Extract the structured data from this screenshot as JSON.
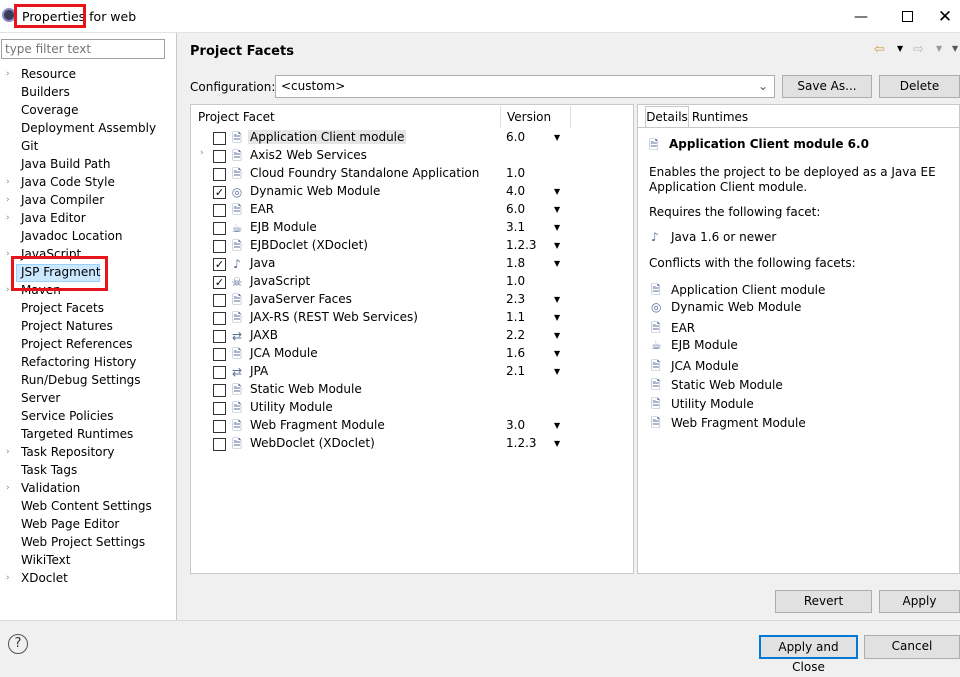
{
  "window": {
    "title": "Properties for web"
  },
  "filter": {
    "placeholder": "type filter text"
  },
  "nav": [
    {
      "label": "Resource",
      "expand": true
    },
    {
      "label": "Builders",
      "expand": false
    },
    {
      "label": "Coverage",
      "expand": false
    },
    {
      "label": "Deployment Assembly",
      "expand": false
    },
    {
      "label": "Git",
      "expand": false
    },
    {
      "label": "Java Build Path",
      "expand": false
    },
    {
      "label": "Java Code Style",
      "expand": true
    },
    {
      "label": "Java Compiler",
      "expand": true
    },
    {
      "label": "Java Editor",
      "expand": true
    },
    {
      "label": "Javadoc Location",
      "expand": false
    },
    {
      "label": "JavaScript",
      "expand": true
    },
    {
      "label": "JSP Fragment",
      "expand": false
    },
    {
      "label": "Maven",
      "expand": true
    },
    {
      "label": "Project Facets",
      "expand": false,
      "selected": true
    },
    {
      "label": "Project Natures",
      "expand": false
    },
    {
      "label": "Project References",
      "expand": false
    },
    {
      "label": "Refactoring History",
      "expand": false
    },
    {
      "label": "Run/Debug Settings",
      "expand": false
    },
    {
      "label": "Server",
      "expand": false
    },
    {
      "label": "Service Policies",
      "expand": false
    },
    {
      "label": "Targeted Runtimes",
      "expand": false
    },
    {
      "label": "Task Repository",
      "expand": true
    },
    {
      "label": "Task Tags",
      "expand": false
    },
    {
      "label": "Validation",
      "expand": true
    },
    {
      "label": "Web Content Settings",
      "expand": false
    },
    {
      "label": "Web Page Editor",
      "expand": false
    },
    {
      "label": "Web Project Settings",
      "expand": false
    },
    {
      "label": "WikiText",
      "expand": false
    },
    {
      "label": "XDoclet",
      "expand": true
    }
  ],
  "page": {
    "heading": "Project Facets"
  },
  "configuration": {
    "label": "Configuration:",
    "value": "<custom>",
    "save_as": "Save As...",
    "delete": "Delete"
  },
  "facets_table": {
    "headers": [
      "Project Facet",
      "Version"
    ],
    "rows": [
      {
        "name": "Application Client module",
        "version": "6.0",
        "checked": false,
        "dropdown": true,
        "expander": false,
        "icon": "page-icon",
        "highlight": true
      },
      {
        "name": "Axis2 Web Services",
        "version": "",
        "checked": false,
        "dropdown": false,
        "expander": true,
        "icon": "page-icon"
      },
      {
        "name": "Cloud Foundry Standalone Application",
        "version": "1.0",
        "checked": false,
        "dropdown": false,
        "expander": false,
        "icon": "page-icon"
      },
      {
        "name": "Dynamic Web Module",
        "version": "4.0",
        "checked": true,
        "dropdown": true,
        "expander": false,
        "icon": "globe-icon"
      },
      {
        "name": "EAR",
        "version": "6.0",
        "checked": false,
        "dropdown": true,
        "expander": false,
        "icon": "page-icon"
      },
      {
        "name": "EJB Module",
        "version": "3.1",
        "checked": false,
        "dropdown": true,
        "expander": false,
        "icon": "bean-icon"
      },
      {
        "name": "EJBDoclet (XDoclet)",
        "version": "1.2.3",
        "checked": false,
        "dropdown": true,
        "expander": false,
        "icon": "page-icon"
      },
      {
        "name": "Java",
        "version": "1.8",
        "checked": true,
        "dropdown": true,
        "expander": false,
        "icon": "java-icon"
      },
      {
        "name": "JavaScript",
        "version": "1.0",
        "checked": true,
        "dropdown": false,
        "expander": false,
        "icon": "js-icon"
      },
      {
        "name": "JavaServer Faces",
        "version": "2.3",
        "checked": false,
        "dropdown": true,
        "expander": false,
        "icon": "page-icon"
      },
      {
        "name": "JAX-RS (REST Web Services)",
        "version": "1.1",
        "checked": false,
        "dropdown": true,
        "expander": false,
        "icon": "page-icon"
      },
      {
        "name": "JAXB",
        "version": "2.2",
        "checked": false,
        "dropdown": true,
        "expander": false,
        "icon": "arrows-icon"
      },
      {
        "name": "JCA Module",
        "version": "1.6",
        "checked": false,
        "dropdown": true,
        "expander": false,
        "icon": "page-icon"
      },
      {
        "name": "JPA",
        "version": "2.1",
        "checked": false,
        "dropdown": true,
        "expander": false,
        "icon": "arrows-icon"
      },
      {
        "name": "Static Web Module",
        "version": "",
        "checked": false,
        "dropdown": false,
        "expander": false,
        "icon": "page-icon"
      },
      {
        "name": "Utility Module",
        "version": "",
        "checked": false,
        "dropdown": false,
        "expander": false,
        "icon": "page-icon"
      },
      {
        "name": "Web Fragment Module",
        "version": "3.0",
        "checked": false,
        "dropdown": true,
        "expander": false,
        "icon": "page-icon"
      },
      {
        "name": "WebDoclet (XDoclet)",
        "version": "1.2.3",
        "checked": false,
        "dropdown": true,
        "expander": false,
        "icon": "page-icon"
      }
    ]
  },
  "details": {
    "tabs": [
      "Details",
      "Runtimes"
    ],
    "title": "Application Client module 6.0",
    "description_line1": "Enables the project to be deployed as a Java EE",
    "description_line2": "Application Client module.",
    "requires_label": "Requires the following facet:",
    "requires": [
      {
        "name": "Java 1.6 or newer",
        "icon": "java-icon"
      }
    ],
    "conflicts_label": "Conflicts with the following facets:",
    "conflicts": [
      {
        "name": "Application Client module",
        "icon": "page-icon"
      },
      {
        "name": "Dynamic Web Module",
        "icon": "globe-icon"
      },
      {
        "name": "EAR",
        "icon": "page-icon"
      },
      {
        "name": "EJB Module",
        "icon": "bean-icon"
      },
      {
        "name": "JCA Module",
        "icon": "page-icon"
      },
      {
        "name": "Static Web Module",
        "icon": "page-icon"
      },
      {
        "name": "Utility Module",
        "icon": "page-icon"
      },
      {
        "name": "Web Fragment Module",
        "icon": "page-icon"
      }
    ]
  },
  "buttons": {
    "revert": "Revert",
    "apply": "Apply",
    "apply_close": "Apply and Close",
    "cancel": "Cancel"
  },
  "colors": {
    "selection": "#cce8ff",
    "annotation": "#e8141c",
    "accent_button_border": "#0078d7"
  }
}
